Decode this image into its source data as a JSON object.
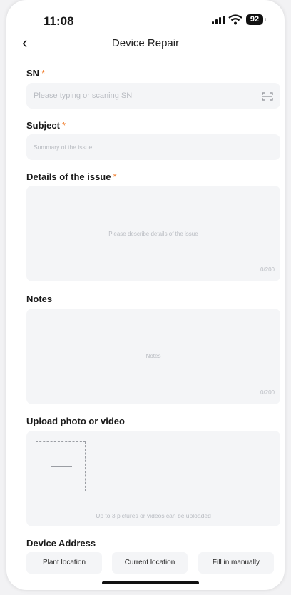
{
  "status_bar": {
    "time": "11:08",
    "battery": "92"
  },
  "nav": {
    "title": "Device Repair"
  },
  "sn": {
    "label": "SN",
    "required_mark": "*",
    "placeholder": "Please typing or scaning SN"
  },
  "subject": {
    "label": "Subject",
    "required_mark": "*",
    "placeholder": "Summary of the issue"
  },
  "details": {
    "label": "Details of the issue",
    "required_mark": "*",
    "placeholder": "Please describe details of the issue",
    "counter": "0/200"
  },
  "notes": {
    "label": "Notes",
    "placeholder": "Notes",
    "counter": "0/200"
  },
  "upload": {
    "label": "Upload photo or video",
    "hint": "Up to 3 pictures or videos can be uploaded"
  },
  "address": {
    "label": "Device Address",
    "options": [
      "Plant location",
      "Current location",
      "Fill in manually"
    ]
  },
  "colors": {
    "accent_required": "#f07c2a",
    "field_bg": "#f4f5f7",
    "placeholder": "#b9bcc2"
  },
  "icons": {
    "back": "chevron-left-icon",
    "scan": "scan-icon",
    "add": "plus-icon"
  }
}
